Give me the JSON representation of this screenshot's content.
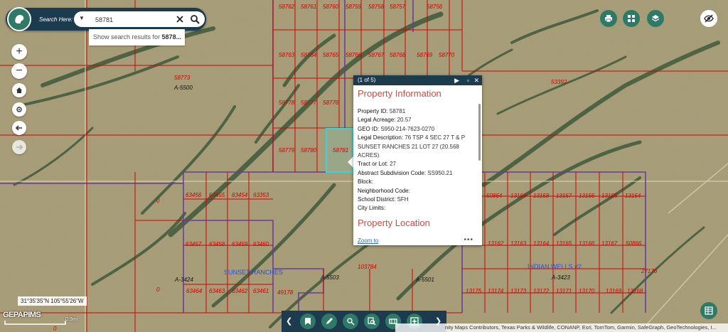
{
  "colors": {
    "accent": "#2f7a66",
    "bar": "#1d3b4f",
    "parcel_line": "#d00000",
    "tract_line": "#6a3d9a",
    "highlight": "#3fd0d8",
    "popup_title": "#d4483e"
  },
  "search": {
    "label": "Search Here:",
    "value": "58781",
    "suggestion_prefix": "Show search results for ",
    "suggestion_term": "5878..."
  },
  "parcels": [
    {
      "label": "58762"
    },
    {
      "label": "58761"
    },
    {
      "label": "58760"
    },
    {
      "label": "58759"
    },
    {
      "label": "58758"
    },
    {
      "label": "58757"
    },
    {
      "label": "58756"
    },
    {
      "label": "58763"
    },
    {
      "label": "58764"
    },
    {
      "label": "58765"
    },
    {
      "label": "58766"
    },
    {
      "label": "58767"
    },
    {
      "label": "58768"
    },
    {
      "label": "58769"
    },
    {
      "label": "58770"
    },
    {
      "label": "58778"
    },
    {
      "label": "58777"
    },
    {
      "label": "58776"
    },
    {
      "label": "58779"
    },
    {
      "label": "58780"
    },
    {
      "label": "58781"
    },
    {
      "label": "58773"
    },
    {
      "label": "53392"
    },
    {
      "label": "63456"
    },
    {
      "label": "63455"
    },
    {
      "label": "63454"
    },
    {
      "label": "63353"
    },
    {
      "label": "63457"
    },
    {
      "label": "63458"
    },
    {
      "label": "63459"
    },
    {
      "label": "63460"
    },
    {
      "label": "63464"
    },
    {
      "label": "63463"
    },
    {
      "label": "63462"
    },
    {
      "label": "63461"
    },
    {
      "label": "49178"
    },
    {
      "label": "103784"
    },
    {
      "label": "50864"
    },
    {
      "label": "13159"
    },
    {
      "label": "13158"
    },
    {
      "label": "13157"
    },
    {
      "label": "13156"
    },
    {
      "label": "13155"
    },
    {
      "label": "13154"
    },
    {
      "label": "13162"
    },
    {
      "label": "13163"
    },
    {
      "label": "13164"
    },
    {
      "label": "13165"
    },
    {
      "label": "13166"
    },
    {
      "label": "13167"
    },
    {
      "label": "50866"
    },
    {
      "label": "13175"
    },
    {
      "label": "13174"
    },
    {
      "label": "13173"
    },
    {
      "label": "13172"
    },
    {
      "label": "13171"
    },
    {
      "label": "13170"
    },
    {
      "label": "13169"
    },
    {
      "label": "13168"
    },
    {
      "label": "27176"
    },
    {
      "label": "0"
    },
    {
      "label": "0"
    },
    {
      "label": "0"
    }
  ],
  "abstracts": [
    "A-5500",
    "A-3424",
    "A-5503",
    "A-5501",
    "A-3423"
  ],
  "subdivisions": [
    "SUNSET RANCHES",
    "INDIAN WELLS #2"
  ],
  "popup": {
    "counter": "(1 of 5)",
    "title": "Property Information",
    "fields": [
      {
        "label": "Property ID:",
        "value": "58781"
      },
      {
        "label": "Legal Acreage:",
        "value": "20.57"
      },
      {
        "label": "GEO ID:",
        "value": "S950-214-7623-0270"
      },
      {
        "label": "Legal Description:",
        "value": "76 TSP 4 SEC 27 T & P SUNSET RANCHES 21 LOT 27 (20.568 ACRES)"
      },
      {
        "label": "Tract or Lot:",
        "value": "27"
      },
      {
        "label": "Abstract Subdivision Code:",
        "value": "SS950.21"
      },
      {
        "label": "Block:",
        "value": ""
      },
      {
        "label": "Neighborhood Code:",
        "value": ""
      },
      {
        "label": "School District:",
        "value": "SFH"
      },
      {
        "label": "City Limits:",
        "value": ""
      }
    ],
    "section2": "Property Location",
    "zoom_label": "Zoom to",
    "more": "•••"
  },
  "coords": "31°35'35\"N 105°55'26\"W",
  "wordmark": "GEPAPIMS",
  "scale_label": "0.3mi",
  "attribution": "nity Maps Contributors, Texas Parks & Wildlife, CONANP, Esri, TomTom, Garmin, SafeGraph, GeoTechnologies, I..."
}
